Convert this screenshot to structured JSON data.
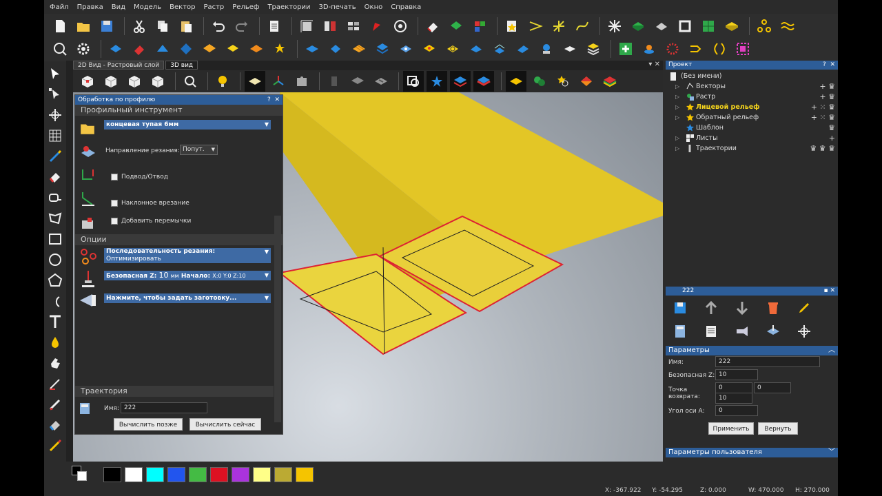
{
  "menu": [
    "Файл",
    "Правка",
    "Вид",
    "Модель",
    "Вектор",
    "Растр",
    "Рельеф",
    "Траектории",
    "3D-печать",
    "Окно",
    "Справка"
  ],
  "view_tabs": {
    "tab_2d": "2D Вид - Растровый слой",
    "tab_3d": "3D вид"
  },
  "profile_panel": {
    "title": "Обработка по профилю",
    "help": "?",
    "close": "✕",
    "section_tool": "Профильный инструмент",
    "tool_name": "концевая тупая 6мм",
    "cut_direction_label": "Направление резания:",
    "cut_direction_value": "Попут.",
    "lead_in_label": "Подвод/Отвод",
    "ramp_label": "Наклонное врезание",
    "bridges_label": "Добавить перемычки",
    "section_options": "Опции",
    "sequence_label": "Последовательность резания:",
    "sequence_value": "Оптимизировать",
    "safe_z_label": "Безопасная Z:",
    "safe_z_value": "10",
    "safe_z_unit": "мм",
    "start_label": "Начало:",
    "start_value": "X:0 Y:0 Z:10",
    "material_label": "Нажмите, чтобы задать заготовку...",
    "section_toolpath": "Траектория",
    "name_label": "Имя:",
    "name_value": "222",
    "calc_later": "Вычислить позже",
    "calc_now": "Вычислить сейчас"
  },
  "project": {
    "title": "Проект",
    "pin": "?",
    "close": "✕",
    "root": "(Без имени)",
    "items": [
      {
        "label": "Векторы",
        "icon": "vectors-icon"
      },
      {
        "label": "Растр",
        "icon": "raster-icon"
      },
      {
        "label": "Лицевой рельеф",
        "icon": "star-icon",
        "color": "#f2d21d"
      },
      {
        "label": "Обратный рельеф",
        "icon": "star-icon"
      },
      {
        "label": "Шаблон",
        "icon": "star-icon"
      },
      {
        "label": "Листы",
        "icon": "sheets-icon"
      },
      {
        "label": "Траектории",
        "icon": "toolpaths-icon"
      }
    ]
  },
  "toolpath_panel": {
    "title": "222",
    "params_title": "Параметры",
    "name_label": "Имя:",
    "name_value": "222",
    "safe_z_label": "Безопасная Z:",
    "safe_z_value": "10",
    "return_label_1": "Точка",
    "return_label_2": "возврата:",
    "return_x": "0",
    "return_y": "0",
    "return_z": "10",
    "a_axis_label": "Угол оси А:",
    "a_axis_value": "0",
    "apply": "Применить",
    "revert": "Вернуть",
    "user_params": "Параметры пользователя"
  },
  "status": {
    "x": "X: -367.922",
    "y": "Y: -54.295",
    "z": "Z: 0.000",
    "w": "W: 470.000",
    "h": "H: 270.000"
  },
  "palette": [
    "#000000",
    "#ffffff",
    "#00ffff",
    "#2255ee",
    "#44bb44",
    "#dd1122",
    "#aa33dd",
    "#ffff88",
    "#bbaa33",
    "#f5c400"
  ],
  "colors": {
    "accent": "#2d5d98",
    "relief": "#e3c626"
  }
}
